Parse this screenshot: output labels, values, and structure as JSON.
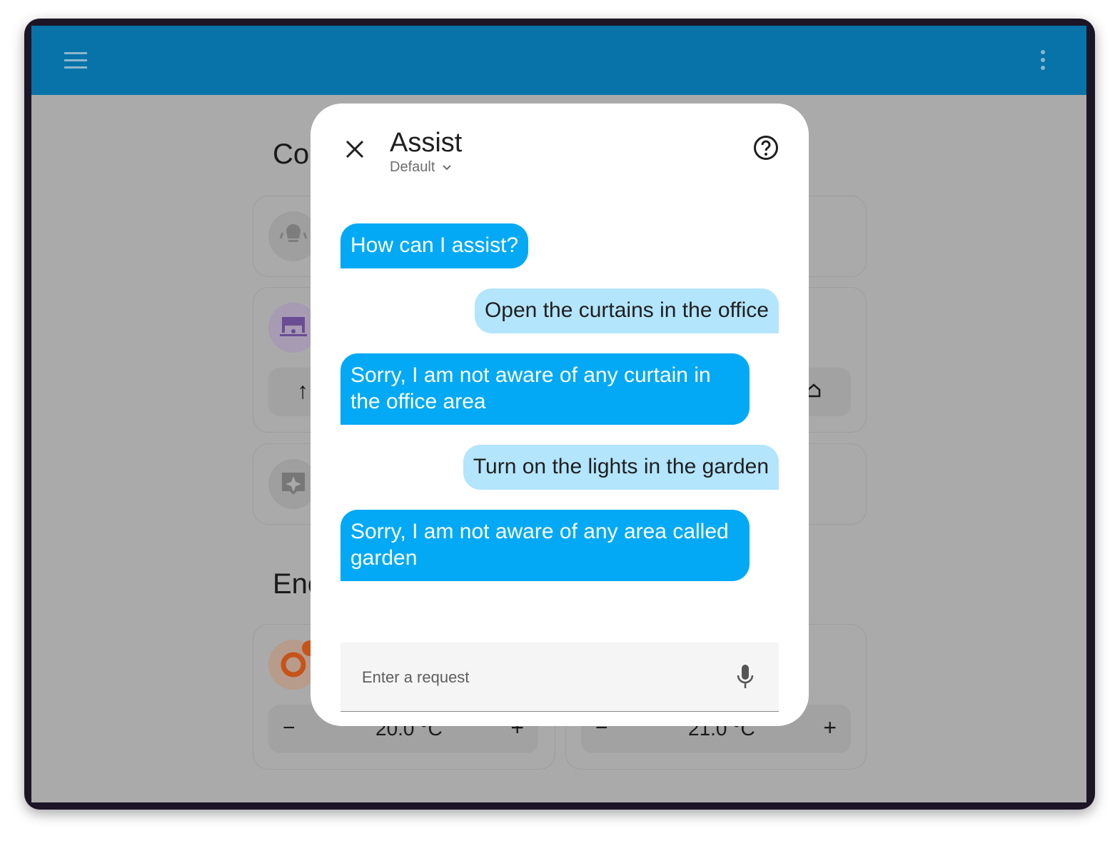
{
  "background": {
    "sections": [
      {
        "title_visible": "Co"
      },
      {
        "title_visible": "Ene"
      }
    ],
    "thermostats": [
      {
        "value": "20.0 °C"
      },
      {
        "value": "21.0 °C"
      }
    ],
    "minus": "−",
    "plus": "+",
    "up_arrow": "↑"
  },
  "dialog": {
    "title": "Assist",
    "pipeline": "Default",
    "messages": [
      {
        "from": "agent",
        "text": "How can I assist?"
      },
      {
        "from": "user",
        "text": "Open the curtains in the office"
      },
      {
        "from": "agent",
        "text": "Sorry, I am not aware of any curtain in the office area"
      },
      {
        "from": "user",
        "text": "Turn on the lights in the garden"
      },
      {
        "from": "agent",
        "text": "Sorry, I am not aware of any area called garden"
      }
    ],
    "input_placeholder": "Enter a request",
    "input_value": ""
  },
  "colors": {
    "header": "#0773a8",
    "agent_bubble": "#03a9f4",
    "user_bubble": "#b3e5fc",
    "scrim": "#aaaaaa"
  }
}
